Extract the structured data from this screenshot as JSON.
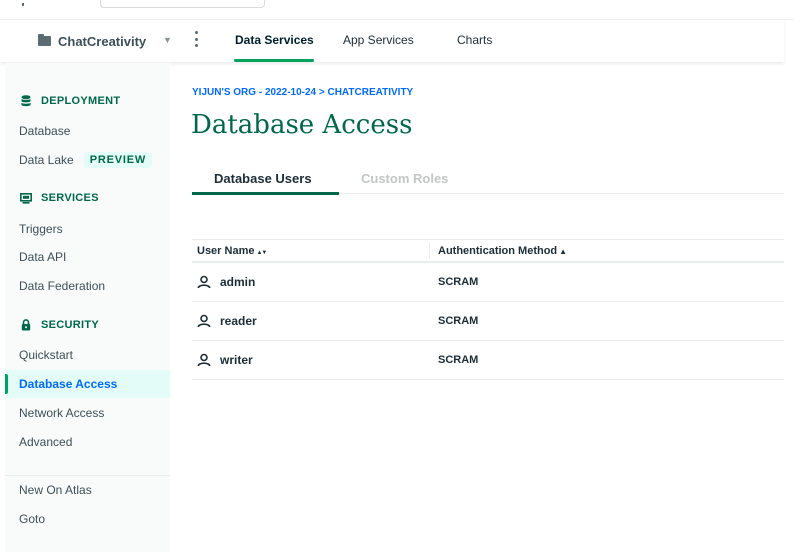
{
  "header": {
    "project_name": "ChatCreativity",
    "tabs": [
      {
        "label": "Data Services",
        "active": true
      },
      {
        "label": "App Services",
        "active": false
      },
      {
        "label": "Charts",
        "active": false
      }
    ]
  },
  "sidebar": {
    "sections": [
      {
        "title": "DEPLOYMENT",
        "icon": "database-stack-icon",
        "items": [
          {
            "label": "Database"
          },
          {
            "label": "Data Lake",
            "badge": "PREVIEW"
          }
        ]
      },
      {
        "title": "SERVICES",
        "icon": "monitor-icon",
        "items": [
          {
            "label": "Triggers"
          },
          {
            "label": "Data API"
          },
          {
            "label": "Data Federation"
          }
        ]
      },
      {
        "title": "SECURITY",
        "icon": "lock-icon",
        "items": [
          {
            "label": "Quickstart"
          },
          {
            "label": "Database Access",
            "active": true
          },
          {
            "label": "Network Access"
          },
          {
            "label": "Advanced"
          }
        ]
      }
    ],
    "footer_items": [
      {
        "label": "New On Atlas"
      },
      {
        "label": "Goto"
      }
    ]
  },
  "main": {
    "breadcrumb": "YIJUN'S ORG - 2022-10-24 > CHATCREATIVITY",
    "title": "Database Access",
    "subtabs": [
      {
        "label": "Database Users",
        "active": true
      },
      {
        "label": "Custom Roles",
        "active": false
      }
    ],
    "table": {
      "columns": [
        {
          "label": "User Name",
          "sort_glyph": "▲▼"
        },
        {
          "label": "Authentication Method",
          "sort_glyph": "▲"
        }
      ],
      "rows": [
        {
          "user": "admin",
          "auth": "SCRAM"
        },
        {
          "user": "reader",
          "auth": "SCRAM"
        },
        {
          "user": "writer",
          "auth": "SCRAM"
        }
      ]
    }
  },
  "colors": {
    "brand_green": "#00684a",
    "accent_green": "#00a35c",
    "link_blue": "#016bf8",
    "active_bg": "#e3fcf7",
    "inactive_tab": "#c1c7c6"
  }
}
